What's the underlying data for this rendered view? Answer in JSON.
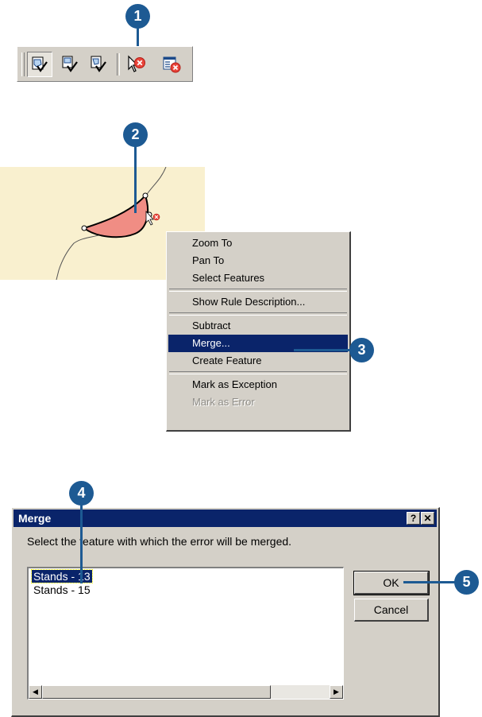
{
  "callouts": [
    "1",
    "2",
    "3",
    "4",
    "5"
  ],
  "toolbar": {
    "tools": [
      "error-inspector-icon",
      "validate-current-extent-icon",
      "validate-selection-icon",
      "fix-topology-error-icon",
      "error-inspector-window-icon"
    ]
  },
  "menu": {
    "items": [
      {
        "label": "Zoom To",
        "state": "enabled"
      },
      {
        "label": "Pan To",
        "state": "enabled"
      },
      {
        "label": "Select Features",
        "state": "enabled"
      },
      {
        "label": "Show Rule Description...",
        "state": "enabled"
      },
      {
        "label": "Subtract",
        "state": "enabled"
      },
      {
        "label": "Merge...",
        "state": "selected"
      },
      {
        "label": "Create Feature",
        "state": "enabled"
      },
      {
        "label": "Mark as Exception",
        "state": "enabled"
      },
      {
        "label": "Mark as Error",
        "state": "disabled"
      }
    ]
  },
  "dialog": {
    "title": "Merge",
    "help_label": "?",
    "close_label": "✕",
    "prompt": "Select the feature with which the error will be merged.",
    "list": [
      "Stands - 13",
      "Stands - 15"
    ],
    "selected_item": "Stands - 13",
    "ok_label": "OK",
    "cancel_label": "Cancel"
  },
  "colors": {
    "callout": "#1d5a93",
    "selection": "#0a246a",
    "map_background": "#f9f0cf",
    "error_polygon": "#f08d84"
  }
}
